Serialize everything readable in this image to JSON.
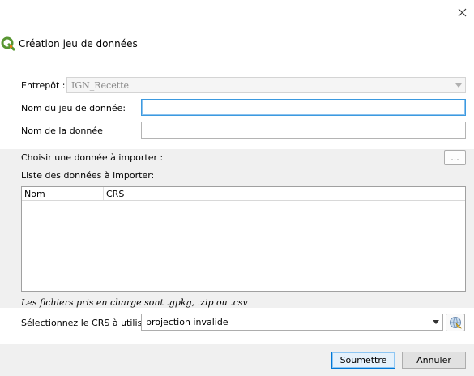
{
  "window": {
    "title": "Création jeu de données",
    "close_icon": "close-icon",
    "logo_icon": "qgis-logo-icon"
  },
  "form": {
    "entrepot_label": "Entrepôt :",
    "entrepot_value": "IGN_Recette",
    "dataset_name_label": "Nom du jeu de donnée:",
    "dataset_name_value": "",
    "data_name_label": "Nom de la donnée",
    "data_name_value": ""
  },
  "import": {
    "choose_label": "Choisir une donnée à importer :",
    "browse_label": "...",
    "list_label": "Liste des données à importer:",
    "columns": [
      "Nom",
      "CRS"
    ],
    "rows": [],
    "hint": "Les fichiers pris en charge sont .gpkg, .zip ou .csv"
  },
  "crs": {
    "label": "Sélectionnez le CRS à utiliser:",
    "value": "projection invalide",
    "picker_icon": "globe-crs-icon"
  },
  "footer": {
    "submit_label": "Soumettre",
    "cancel_label": "Annuler"
  },
  "colors": {
    "accent": "#0078d7",
    "focus": "#3c9ae0",
    "qgis_green": "#589632",
    "qgis_yellow": "#ee7913"
  }
}
